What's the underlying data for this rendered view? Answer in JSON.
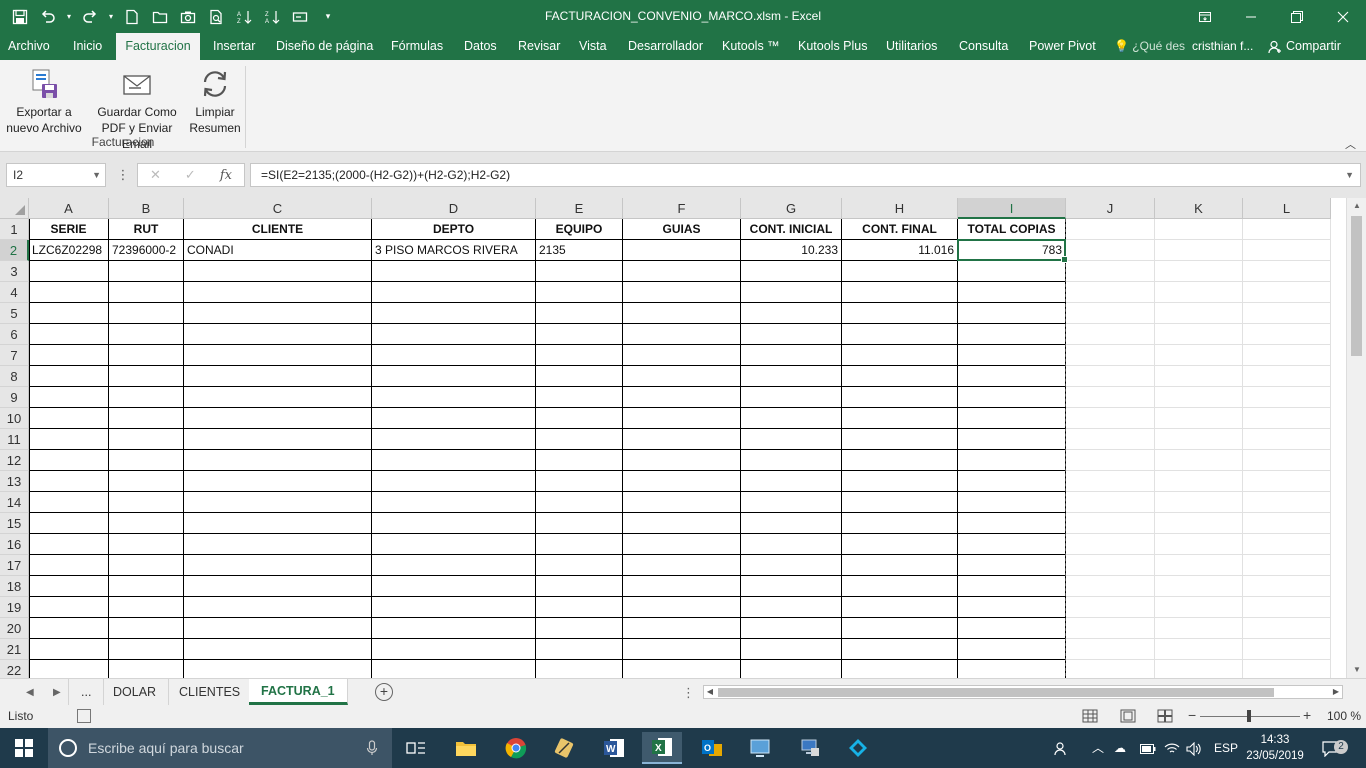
{
  "window": {
    "title": "FACTURACION_CONVENIO_MARCO.xlsm - Excel"
  },
  "ribbon": {
    "tabs": [
      "Archivo",
      "Inicio",
      "Facturacion",
      "Insertar",
      "Diseño de página",
      "Fórmulas",
      "Datos",
      "Revisar",
      "Vista",
      "Desarrollador",
      "Kutools ™",
      "Kutools Plus",
      "Utilitarios",
      "Consulta",
      "Power Pivot"
    ],
    "active_tab": "Facturacion",
    "search_placeholder": "¿Qué des",
    "user": "cristhian f...",
    "share": "Compartir",
    "buttons": [
      {
        "line1": "Exportar a",
        "line2": "nuevo Archivo",
        "icon": "export-file-icon"
      },
      {
        "line1": "Guardar Como",
        "line2": "PDF y Enviar Email",
        "icon": "pdf-email-icon"
      },
      {
        "line1": "Limpiar",
        "line2": "Resumen",
        "icon": "refresh-icon"
      }
    ],
    "group_label": "Facturacion"
  },
  "formula_bar": {
    "name_box": "I2",
    "formula": "=SI(E2=2135;(2000-(H2-G2))+(H2-G2);H2-G2)"
  },
  "grid": {
    "columns": [
      "A",
      "B",
      "C",
      "D",
      "E",
      "F",
      "G",
      "H",
      "I",
      "J",
      "K",
      "L"
    ],
    "selected_column": "I",
    "rows": [
      "1",
      "2",
      "3",
      "4",
      "5",
      "6",
      "7",
      "8",
      "9",
      "10",
      "11",
      "12",
      "13",
      "14",
      "15",
      "16",
      "17",
      "18",
      "19",
      "20",
      "21",
      "22"
    ],
    "selected_row": "2",
    "headers": [
      "SERIE",
      "RUT",
      "CLIENTE",
      "DEPTO",
      "EQUIPO",
      "GUIAS",
      "CONT. INICIAL",
      "CONT. FINAL",
      "TOTAL COPIAS"
    ],
    "data_row": [
      "LZC6Z02298",
      "72396000-2",
      "CONADI",
      "3 PISO MARCOS RIVERA",
      "2135",
      "",
      "10.233",
      "11.016",
      "783"
    ]
  },
  "sheets": {
    "nav_more": "...",
    "tabs": [
      "DOLAR",
      "CLIENTES",
      "FACTURA_1"
    ],
    "active": "FACTURA_1"
  },
  "status": {
    "ready": "Listo",
    "zoom": "100 %"
  },
  "taskbar": {
    "search_placeholder": "Escribe aquí para buscar",
    "lang": "ESP",
    "time": "14:33",
    "date": "23/05/2019",
    "notifications": "2"
  },
  "colors": {
    "excel_green": "#217346",
    "taskbar": "#1f3a4b"
  }
}
